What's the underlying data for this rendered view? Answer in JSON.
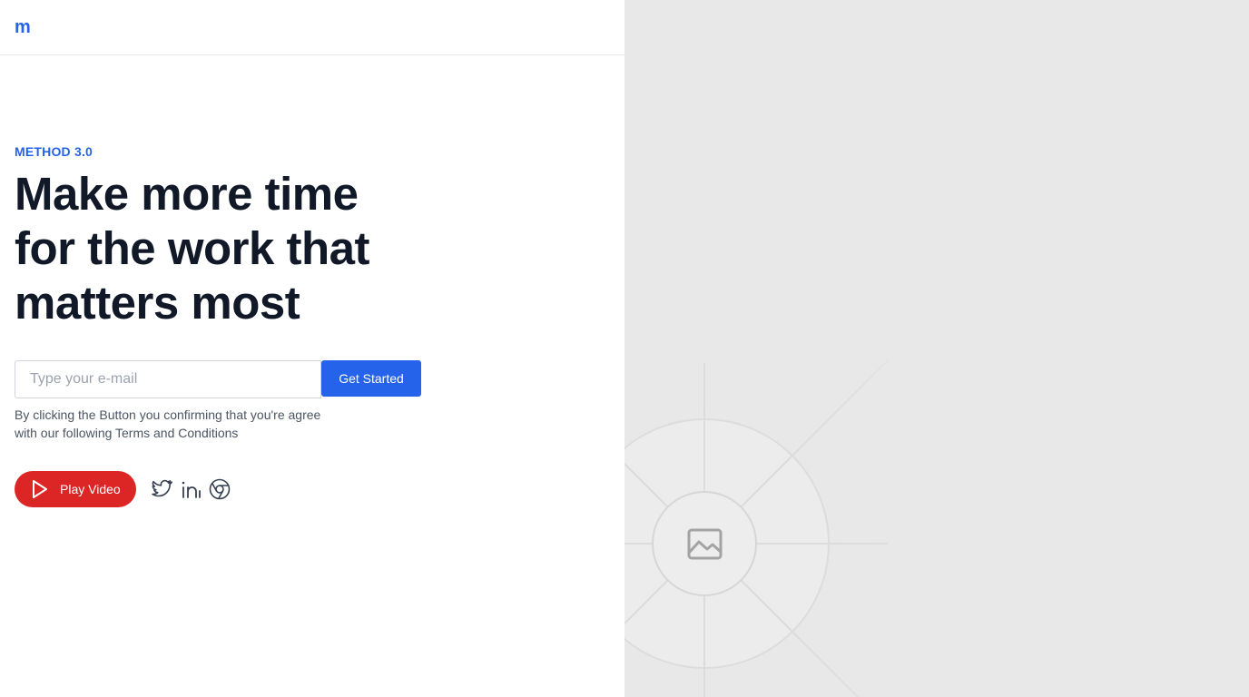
{
  "brand": {
    "logo_text": "m",
    "accent_color": "#2563eb"
  },
  "hero": {
    "eyebrow": "METHOD 3.0",
    "headline": "Make more time for the work that matters most"
  },
  "signup": {
    "email_placeholder": "Type your e-mail",
    "email_value": "",
    "submit_label": "Get Started",
    "disclaimer_line1": "By clicking the Button you confirming that you're agree",
    "disclaimer_line2": "with our following Terms and Conditions"
  },
  "actions": {
    "play_label": "Play Video",
    "play_color": "#dc2626",
    "social_icons": [
      "twitter-icon",
      "linkedin-icon",
      "chrome-icon"
    ]
  },
  "media": {
    "placeholder_icon": "image-placeholder-icon",
    "background_color": "#e8e8e8"
  }
}
